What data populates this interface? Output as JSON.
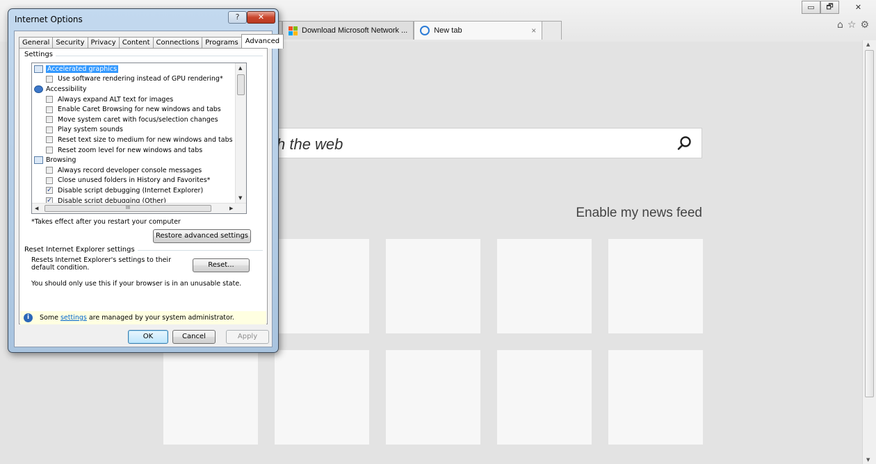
{
  "browser": {
    "tabs": [
      {
        "label": "Download Microsoft Network ..."
      },
      {
        "label": "New tab",
        "close": "×"
      }
    ],
    "window_controls": {
      "minimize": "▭",
      "restore": "🗗",
      "close": "✕"
    },
    "right_icons": {
      "home": "⌂",
      "favorites": "☆",
      "tools": "⚙"
    }
  },
  "page": {
    "search_placeholder": "ch the web",
    "news_feed_label": "Enable my news feed"
  },
  "dialog": {
    "title": "Internet Options",
    "help_label": "?",
    "close_label": "✕",
    "tabs": [
      "General",
      "Security",
      "Privacy",
      "Content",
      "Connections",
      "Programs",
      "Advanced"
    ],
    "active_tab": "Advanced",
    "settings_group_label": "Settings",
    "settings_tree": [
      {
        "type": "category",
        "label": "Accelerated graphics",
        "selected": true,
        "icon": "monitor-icon"
      },
      {
        "type": "option",
        "label": "Use software rendering instead of GPU rendering*",
        "checked": false
      },
      {
        "type": "category",
        "label": "Accessibility",
        "icon": "accessibility-icon"
      },
      {
        "type": "option",
        "label": "Always expand ALT text for images",
        "checked": false
      },
      {
        "type": "option",
        "label": "Enable Caret Browsing for new windows and tabs",
        "checked": false
      },
      {
        "type": "option",
        "label": "Move system caret with focus/selection changes",
        "checked": false
      },
      {
        "type": "option",
        "label": "Play system sounds",
        "checked": false
      },
      {
        "type": "option",
        "label": "Reset text size to medium for new windows and tabs",
        "checked": false
      },
      {
        "type": "option",
        "label": "Reset zoom level for new windows and tabs",
        "checked": false
      },
      {
        "type": "category",
        "label": "Browsing",
        "icon": "window-icon"
      },
      {
        "type": "option",
        "label": "Always record developer console messages",
        "checked": false
      },
      {
        "type": "option",
        "label": "Close unused folders in History and Favorites*",
        "checked": false
      },
      {
        "type": "option",
        "label": "Disable script debugging (Internet Explorer)",
        "checked": true
      },
      {
        "type": "option",
        "label": "Disable script debugging (Other)",
        "checked": true
      }
    ],
    "restart_note": "*Takes effect after you restart your computer",
    "restore_button": "Restore advanced settings",
    "reset_group_label": "Reset Internet Explorer settings",
    "reset_description": "Resets Internet Explorer's settings to their default condition.",
    "reset_button": "Reset...",
    "reset_warning": "You should only use this if your browser is in an unusable state.",
    "info_prefix": "Some ",
    "info_link": "settings",
    "info_suffix": " are managed by your system administrator.",
    "ok_button": "OK",
    "cancel_button": "Cancel",
    "apply_button": "Apply"
  }
}
